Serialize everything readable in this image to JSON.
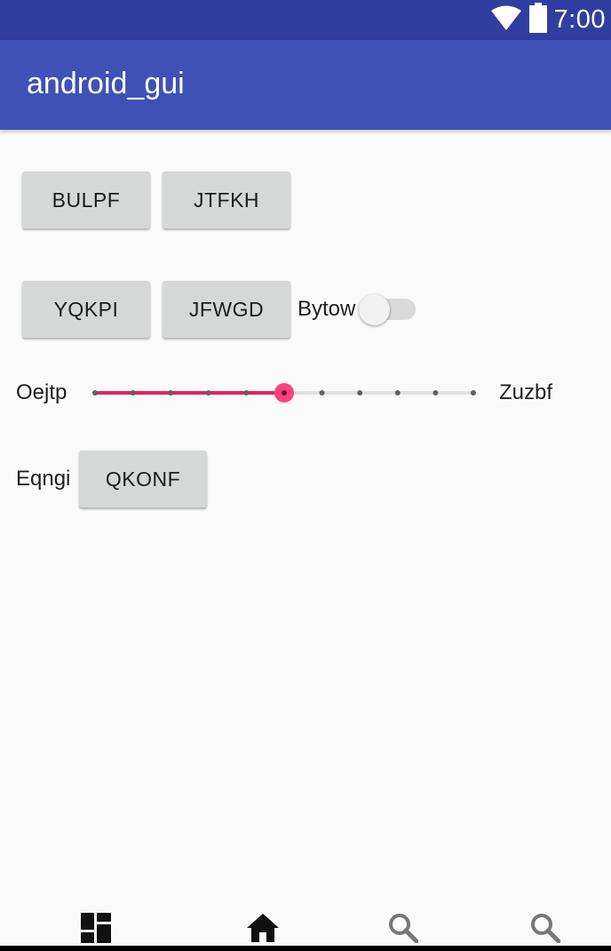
{
  "status_bar": {
    "time": "7:00",
    "icons": [
      "wifi-icon",
      "battery-icon"
    ],
    "color": "#303f9f"
  },
  "app_bar": {
    "title": "android_gui",
    "color": "#3f51b5"
  },
  "row1": {
    "button1": "BULPF",
    "button2": "JTFKH"
  },
  "row2": {
    "button1": "YQKPI",
    "button2": "JFWGD",
    "switch_label": "Bytow",
    "switch_on": false
  },
  "slider": {
    "left_label": "Oejtp",
    "right_label": "Zuzbf",
    "steps": 10,
    "value": 5,
    "accent": "#e91e63"
  },
  "row4": {
    "label": "Eqngi",
    "button": "QKONF"
  },
  "bottom_nav": {
    "icons": [
      "dashboard-icon",
      "home-icon",
      "search-icon",
      "search-icon"
    ]
  }
}
